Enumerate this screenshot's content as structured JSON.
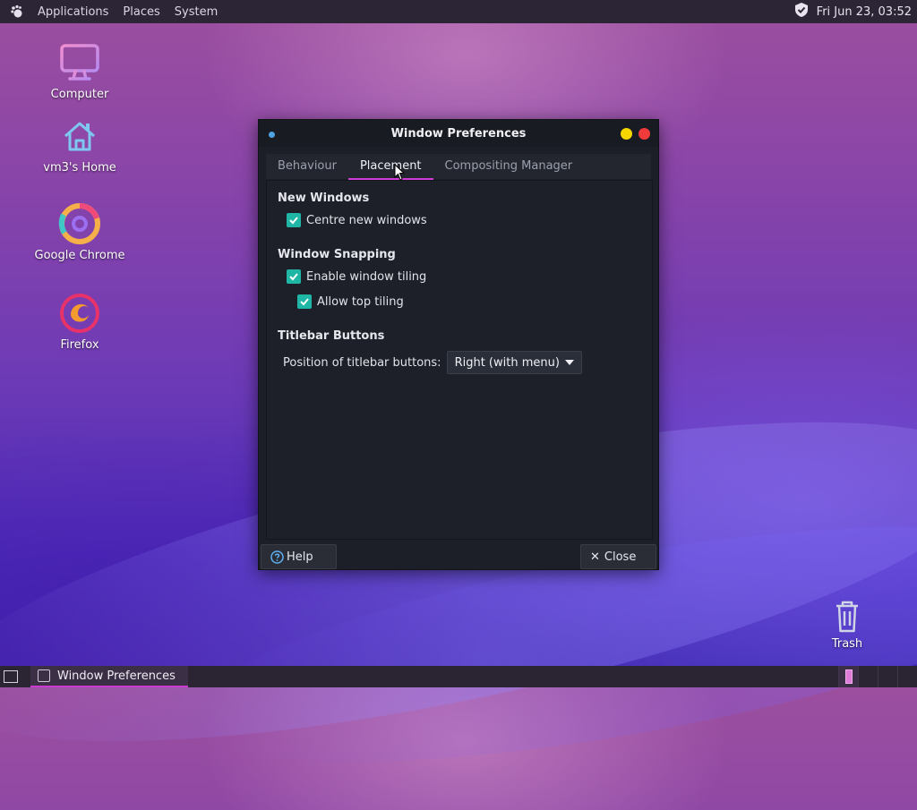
{
  "top_panel": {
    "menu": [
      "Applications",
      "Places",
      "System"
    ],
    "clock": "Fri Jun 23, 03:52",
    "icons": [
      "gnome-foot-icon",
      "shield-check-icon"
    ]
  },
  "desktop": {
    "icons": [
      {
        "label": "Computer",
        "icon": "monitor-icon"
      },
      {
        "label": "vm3's Home",
        "icon": "home-icon"
      },
      {
        "label": "Google Chrome",
        "icon": "chrome-icon"
      },
      {
        "label": "Firefox",
        "icon": "firefox-icon"
      }
    ],
    "trash_label": "Trash"
  },
  "window": {
    "title": "Window Preferences",
    "tabs": [
      "Behaviour",
      "Placement",
      "Compositing Manager"
    ],
    "active_tab": "Placement",
    "sections": {
      "new_windows": {
        "title": "New Windows",
        "centre_label": "Centre new windows",
        "centre_checked": true
      },
      "snapping": {
        "title": "Window Snapping",
        "tiling_label": "Enable window tiling",
        "tiling_checked": true,
        "top_label": "Allow top tiling",
        "top_checked": true
      },
      "titlebar": {
        "title": "Titlebar Buttons",
        "position_label": "Position of titlebar buttons:",
        "position_value": "Right (with menu)"
      }
    },
    "buttons": {
      "help": "Help",
      "close": "Close"
    }
  },
  "taskbar": {
    "task_label": "Window Preferences"
  },
  "colors": {
    "accent": "#d03ad6",
    "checkbox": "#1fb6a5",
    "minimize": "#f5d600",
    "close": "#ef3b3b"
  }
}
